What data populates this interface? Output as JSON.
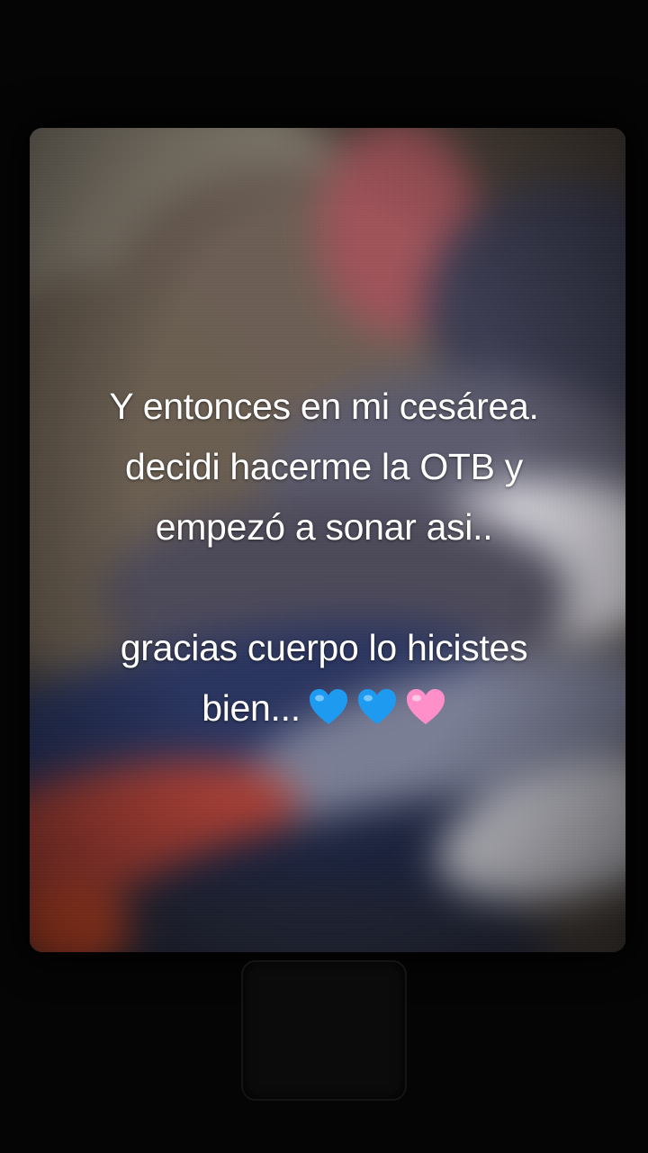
{
  "caption": {
    "line1": "Y entonces en mi cesárea.",
    "line2": "decidi hacerme la OTB y",
    "line3": "empezó a sonar asi..",
    "line4": "gracias cuerpo lo hicistes",
    "line5": "bien..."
  },
  "hearts": [
    {
      "icon": "blue-heart-icon",
      "color": "#1e9bf0"
    },
    {
      "icon": "blue-heart-icon",
      "color": "#1e9bf0"
    },
    {
      "icon": "pink-heart-icon",
      "color": "#ff8fc8"
    }
  ]
}
